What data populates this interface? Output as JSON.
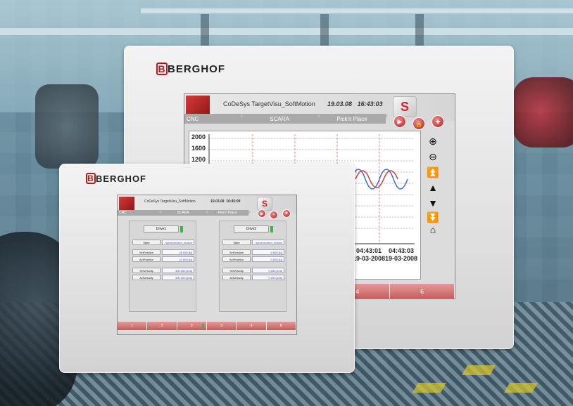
{
  "brand": "BERGHOF",
  "brand_logo_letter": "B",
  "screens": {
    "large": {
      "title": "CoDeSys TargetVisu_SoftMotion",
      "date": "19.03.08",
      "time": "16:43:03",
      "breadcrumbs": [
        "CNC",
        "SCARA",
        "Pick'n Place"
      ],
      "header_buttons": [
        "play",
        "lock",
        "language"
      ],
      "y_ticks": [
        "2000",
        "1600",
        "1200"
      ],
      "x_ticks": [
        {
          "time": "04:43:01",
          "date": "19-03-2008"
        },
        {
          "time": "04:43:03",
          "date": "19-03-2008"
        }
      ],
      "side_buttons": [
        "zoom-in",
        "zoom-out",
        "page-up",
        "up",
        "down",
        "page-down",
        "home"
      ],
      "tabs": [
        "",
        "4",
        "6"
      ]
    },
    "small": {
      "title": "CoDeSys TargetVisu_SoftMotion",
      "date": "19.03.08",
      "time": "16:45:09",
      "breadcrumbs": [
        "CNC",
        "SCARA",
        "Pick'n Place"
      ],
      "drives": [
        {
          "name": "Drive1",
          "rows": [
            {
              "label": "State",
              "value": "synchronized_motion"
            },
            {
              "label": "SetPosition",
              "value": "25.000 [lu]"
            },
            {
              "label": "ActPosition",
              "value": "21.600 [lu]"
            },
            {
              "label": "SetVelocity",
              "value": "300.000 [lu/s]"
            },
            {
              "label": "ActVelocity",
              "value": "300.000 [lu/s]"
            }
          ]
        },
        {
          "name": "Drive2",
          "rows": [
            {
              "label": "State",
              "value": "synchronized_motion"
            },
            {
              "label": "SetPosition",
              "value": "0.000 [lu]"
            },
            {
              "label": "ActPosition",
              "value": "0.000 [lu]"
            },
            {
              "label": "SetVelocity",
              "value": "0.000 [lu/s]"
            },
            {
              "label": "ActVelocity",
              "value": "0.000 [lu/s]"
            }
          ]
        }
      ],
      "tabs": [
        "1",
        "2",
        "3",
        "3",
        "4",
        "6"
      ]
    }
  },
  "colors": {
    "brand_red": "#b01c1c",
    "tab_red": "#c85a5a",
    "trace_red": "#d43a3a",
    "trace_blue": "#3a6fd4"
  }
}
